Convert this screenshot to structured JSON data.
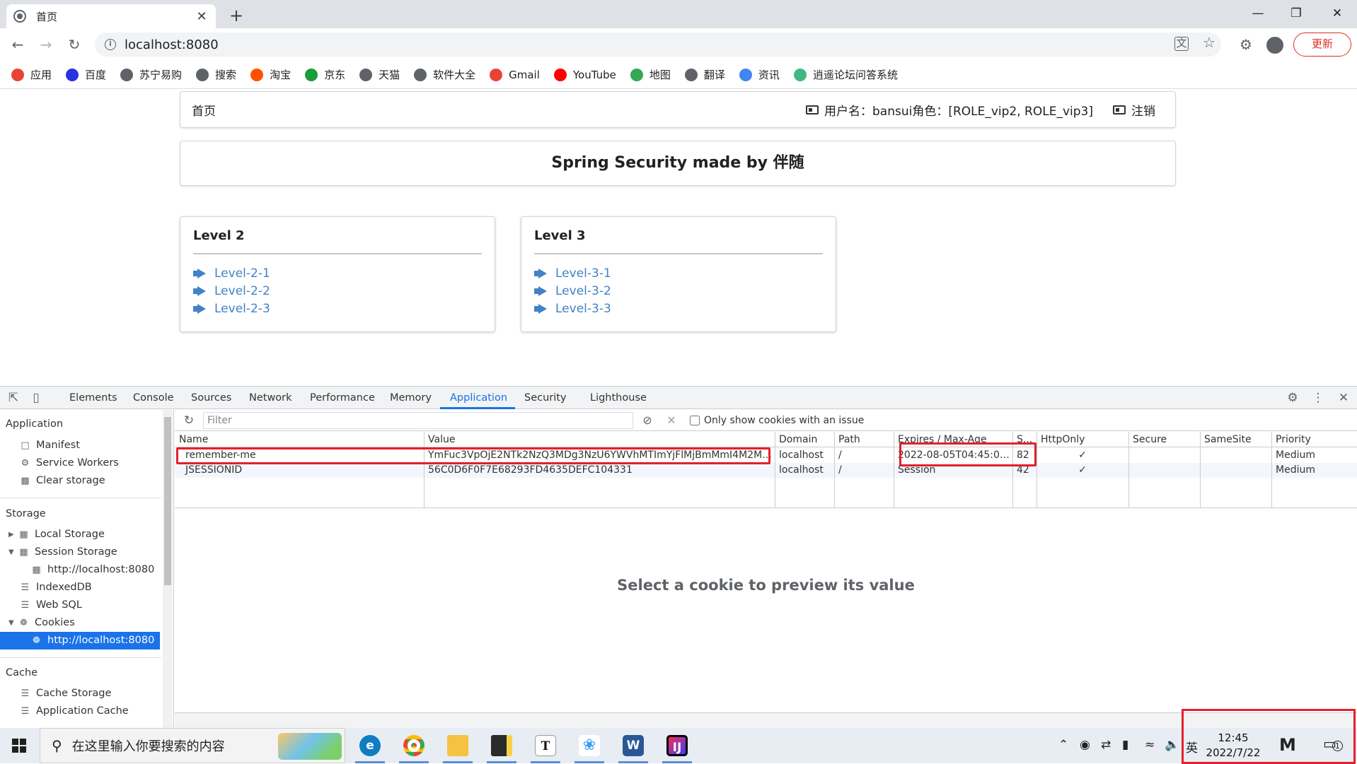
{
  "browser": {
    "tab_title": "首页",
    "tab_close": "✕",
    "new_tab": "+",
    "url": "localhost:8080",
    "update_label": "更新"
  },
  "bookmarks": [
    {
      "label": "应用",
      "icon": "apps-grid-icon",
      "color": "#ea4335"
    },
    {
      "label": "百度",
      "icon": "baidu-paw-icon",
      "color": "#2932e1"
    },
    {
      "label": "苏宁易购",
      "icon": "globe-icon",
      "color": "#5f6368"
    },
    {
      "label": "搜索",
      "icon": "globe-icon",
      "color": "#5f6368"
    },
    {
      "label": "淘宝",
      "icon": "taobao-icon",
      "color": "#ff5000"
    },
    {
      "label": "京东",
      "icon": "jd-icon",
      "color": "#1a9b3c"
    },
    {
      "label": "天猫",
      "icon": "globe-icon",
      "color": "#5f6368"
    },
    {
      "label": "软件大全",
      "icon": "globe-icon",
      "color": "#5f6368"
    },
    {
      "label": "Gmail",
      "icon": "gmail-icon",
      "color": "#ea4335"
    },
    {
      "label": "YouTube",
      "icon": "youtube-icon",
      "color": "#ff0000"
    },
    {
      "label": "地图",
      "icon": "maps-icon",
      "color": "#34a853"
    },
    {
      "label": "翻译",
      "icon": "globe-icon",
      "color": "#5f6368"
    },
    {
      "label": "资讯",
      "icon": "news-icon",
      "color": "#4285f4"
    },
    {
      "label": "逍遥论坛问答系统",
      "icon": "vue-icon",
      "color": "#41b883"
    }
  ],
  "page": {
    "nav_home": "首页",
    "user_info": "用户名：bansui角色：[ROLE_vip2, ROLE_vip3]",
    "logout": "注销",
    "banner": "Spring Security made by 伴随",
    "levels": [
      {
        "title": "Level 2",
        "links": [
          "Level-2-1",
          "Level-2-2",
          "Level-2-3"
        ]
      },
      {
        "title": "Level 3",
        "links": [
          "Level-3-1",
          "Level-3-2",
          "Level-3-3"
        ]
      }
    ]
  },
  "devtools": {
    "tabs": [
      "Elements",
      "Console",
      "Sources",
      "Network",
      "Performance",
      "Memory",
      "Application",
      "Security",
      "Lighthouse"
    ],
    "active_tab": "Application",
    "sidebar": {
      "application_header": "Application",
      "application_items": [
        "Manifest",
        "Service Workers",
        "Clear storage"
      ],
      "storage_header": "Storage",
      "local_storage": "Local Storage",
      "session_storage": "Session Storage",
      "session_origin": "http://localhost:8080",
      "indexeddb": "IndexedDB",
      "websql": "Web SQL",
      "cookies": "Cookies",
      "cookies_origin": "http://localhost:8080",
      "cache_header": "Cache",
      "cache_items": [
        "Cache Storage",
        "Application Cache"
      ]
    },
    "filter_placeholder": "Filter",
    "only_issues_label": "Only show cookies with an issue",
    "columns": [
      "Name",
      "Value",
      "Domain",
      "Path",
      "Expires / Max-Age",
      "S...",
      "HttpOnly",
      "Secure",
      "SameSite",
      "Priority"
    ],
    "rows": [
      {
        "name": "remember-me",
        "value": "YmFuc3VpOjE2NTk2NzQ3MDg3NzU6YWVhMTImYjFlMjBmMmI4M2M2...",
        "domain": "localhost",
        "path": "/",
        "expires": "2022-08-05T04:45:08....",
        "size": "82",
        "httponly": "✓",
        "secure": "",
        "samesite": "",
        "priority": "Medium"
      },
      {
        "name": "JSESSIONID",
        "value": "56C0D6F0F7E68293FD4635DEFC104331",
        "domain": "localhost",
        "path": "/",
        "expires": "Session",
        "size": "42",
        "httponly": "✓",
        "secure": "",
        "samesite": "",
        "priority": "Medium"
      }
    ],
    "preview_message": "Select a cookie to preview its value"
  },
  "taskbar": {
    "search_placeholder": "在这里输入你要搜索的内容",
    "ime": "英",
    "time": "12:45",
    "date": "2022/7/22",
    "notification_count": "1"
  },
  "colors": {
    "accent": "#1a73e8",
    "link": "#4183c4",
    "highlight": "#e3202b"
  }
}
